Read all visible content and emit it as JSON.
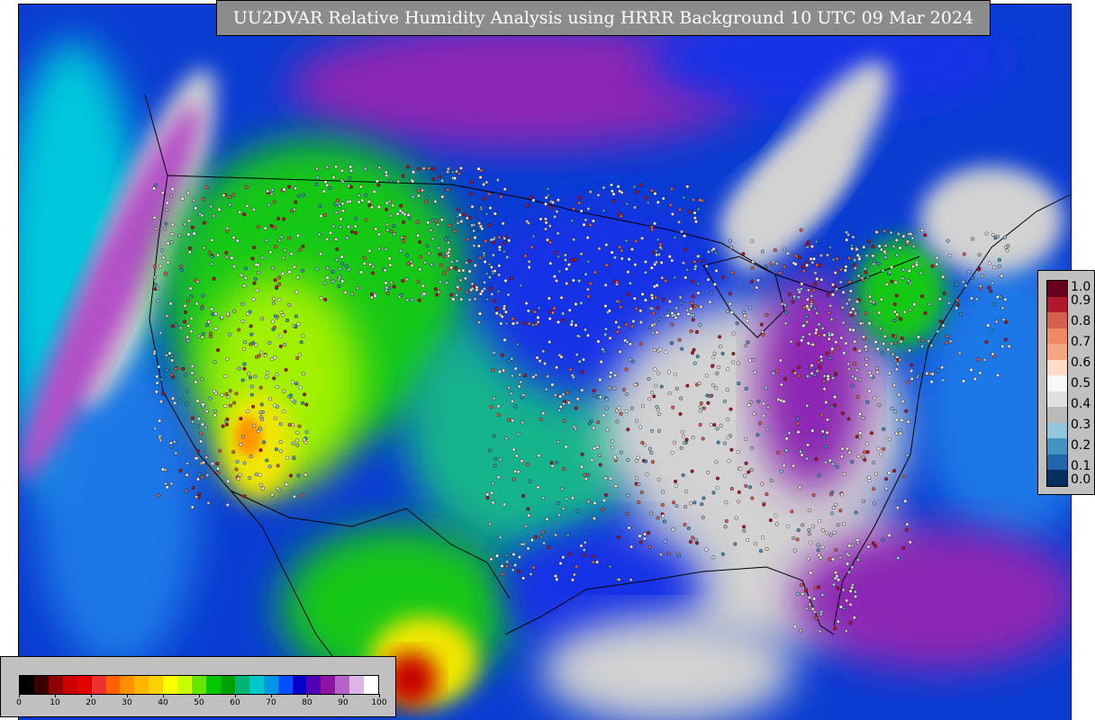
{
  "title": "UU2DVAR Relative Humidity Analysis using HRRR Background 10 UTC 09 Mar 2024",
  "rh_legend": {
    "colors": [
      "#000000",
      "#3a0000",
      "#8c0000",
      "#c80000",
      "#e00000",
      "#f03030",
      "#ff6000",
      "#ff9000",
      "#ffb400",
      "#ffd200",
      "#ffff00",
      "#c8ff00",
      "#64e600",
      "#00c800",
      "#00a000",
      "#00b478",
      "#00c8c8",
      "#0096e6",
      "#0050ff",
      "#0000c8",
      "#5000b4",
      "#8c14a0",
      "#b464c8",
      "#dcb4e6",
      "#ffffff"
    ],
    "tick_labels": [
      "0",
      "10",
      "20",
      "30",
      "40",
      "50",
      "60",
      "70",
      "80",
      "90",
      "100"
    ],
    "tick_values": [
      0,
      10,
      20,
      30,
      40,
      50,
      60,
      70,
      80,
      90,
      100
    ],
    "min": 0,
    "max": 100
  },
  "obs_legend": {
    "colors": [
      "#67001f",
      "#b2182b",
      "#d6604d",
      "#ef8a62",
      "#f4a582",
      "#fddbc7",
      "#f7f7f7",
      "#e0e0e0",
      "#bababa",
      "#92c5de",
      "#4393c3",
      "#2166ac",
      "#053061"
    ],
    "tick_labels": [
      "1.0",
      "0.9",
      "0.8",
      "0.7",
      "0.6",
      "0.5",
      "0.4",
      "0.3",
      "0.2",
      "0.1",
      "0.0"
    ],
    "tick_values": [
      1.0,
      0.9,
      0.8,
      0.7,
      0.6,
      0.5,
      0.4,
      0.3,
      0.2,
      0.1,
      0.0
    ],
    "min": 0.0,
    "max": 1.0
  },
  "map_colors": {
    "ocean_moist": "#0a3cd2",
    "ocean_mid": "#1e78e6",
    "ocean_cyan": "#00c8dc",
    "saturated": "#d2d2d2",
    "purple": "#8c28b4",
    "violet": "#b450c8",
    "green": "#14c814",
    "lime": "#a0f000",
    "yellow": "#f0e600",
    "orange": "#ff9600",
    "red": "#c80000",
    "blue": "#1432e6",
    "teal": "#14b48c",
    "coast": "#000000"
  }
}
